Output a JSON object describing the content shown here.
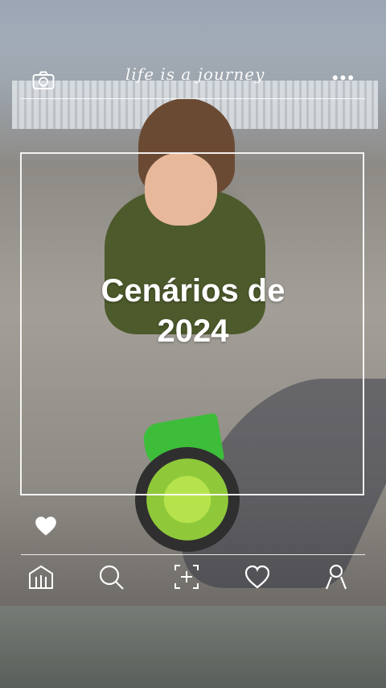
{
  "header": {
    "tagline": "life is a journey",
    "camera_icon": "camera-icon",
    "more_icon": "more-dots-icon"
  },
  "main": {
    "title_line1": "Cenários de",
    "title_line2": "2024"
  },
  "footer": {
    "like_icon": "heart-icon",
    "nav": [
      {
        "icon": "home-icon"
      },
      {
        "icon": "search-icon"
      },
      {
        "icon": "add-icon"
      },
      {
        "icon": "heart-icon"
      },
      {
        "icon": "profile-icon"
      }
    ]
  },
  "colors": {
    "overlay": "#ffffff",
    "bike_green": "#3dbd3a",
    "wheel_lime": "#b6e34c",
    "hat_brown": "#6b4a34",
    "hoodie_olive": "#4d5a2c"
  }
}
